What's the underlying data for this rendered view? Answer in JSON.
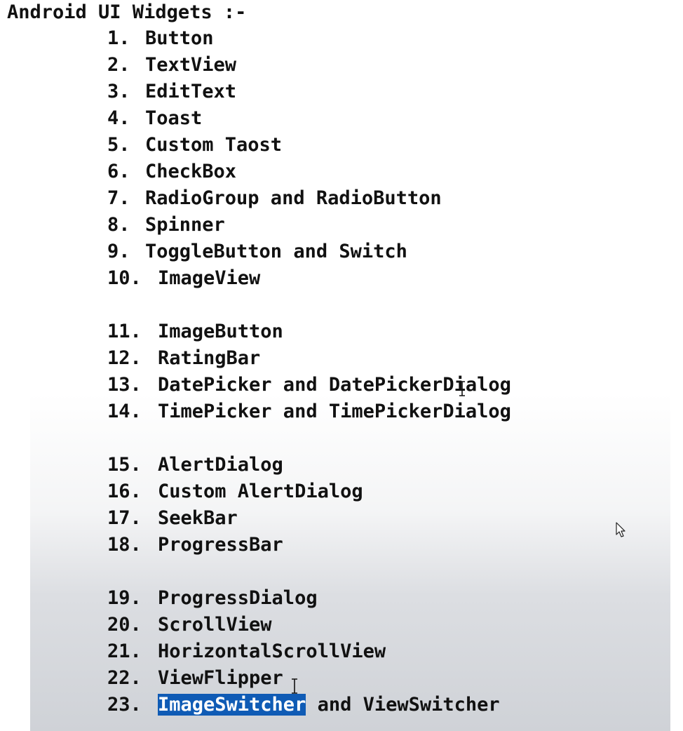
{
  "title": "Android UI Widgets :-",
  "items": [
    {
      "num": "1.",
      "text": "Button"
    },
    {
      "num": "2.",
      "text": "TextView"
    },
    {
      "num": "3.",
      "text": "EditText"
    },
    {
      "num": "4.",
      "text": "Toast"
    },
    {
      "num": "5.",
      "text": "Custom Taost"
    },
    {
      "num": "6.",
      "text": "CheckBox"
    },
    {
      "num": "7.",
      "text": "RadioGroup and RadioButton"
    },
    {
      "num": "8.",
      "text": "Spinner"
    },
    {
      "num": "9.",
      "text": "ToggleButton and Switch"
    },
    {
      "num": "10.",
      "text": "ImageView"
    },
    {
      "num": "11.",
      "text": "ImageButton"
    },
    {
      "num": "12.",
      "text": "RatingBar"
    },
    {
      "num": "13.",
      "text": "DatePicker and DatePickerDialog"
    },
    {
      "num": "14.",
      "text": "TimePicker and TimePickerDialog"
    },
    {
      "num": "15.",
      "text": "AlertDialog"
    },
    {
      "num": "16.",
      "text": "Custom AlertDialog"
    },
    {
      "num": "17.",
      "text": "SeekBar"
    },
    {
      "num": "18.",
      "text": "ProgressBar"
    },
    {
      "num": "19.",
      "text": "ProgressDialog"
    },
    {
      "num": "20.",
      "text": "ScrollView"
    },
    {
      "num": "21.",
      "text": "HorizontalScrollView"
    },
    {
      "num": "22.",
      "text": "ViewFlipper"
    },
    {
      "num": "23.",
      "text_selected": "ImageSwitcher",
      "text_rest": " and ViewSwitcher"
    }
  ],
  "icons": {
    "text_cursor": "text-cursor-icon",
    "mouse_pointer": "mouse-pointer-icon"
  },
  "colors": {
    "selection": "#0f5bb5",
    "text": "#111111"
  }
}
